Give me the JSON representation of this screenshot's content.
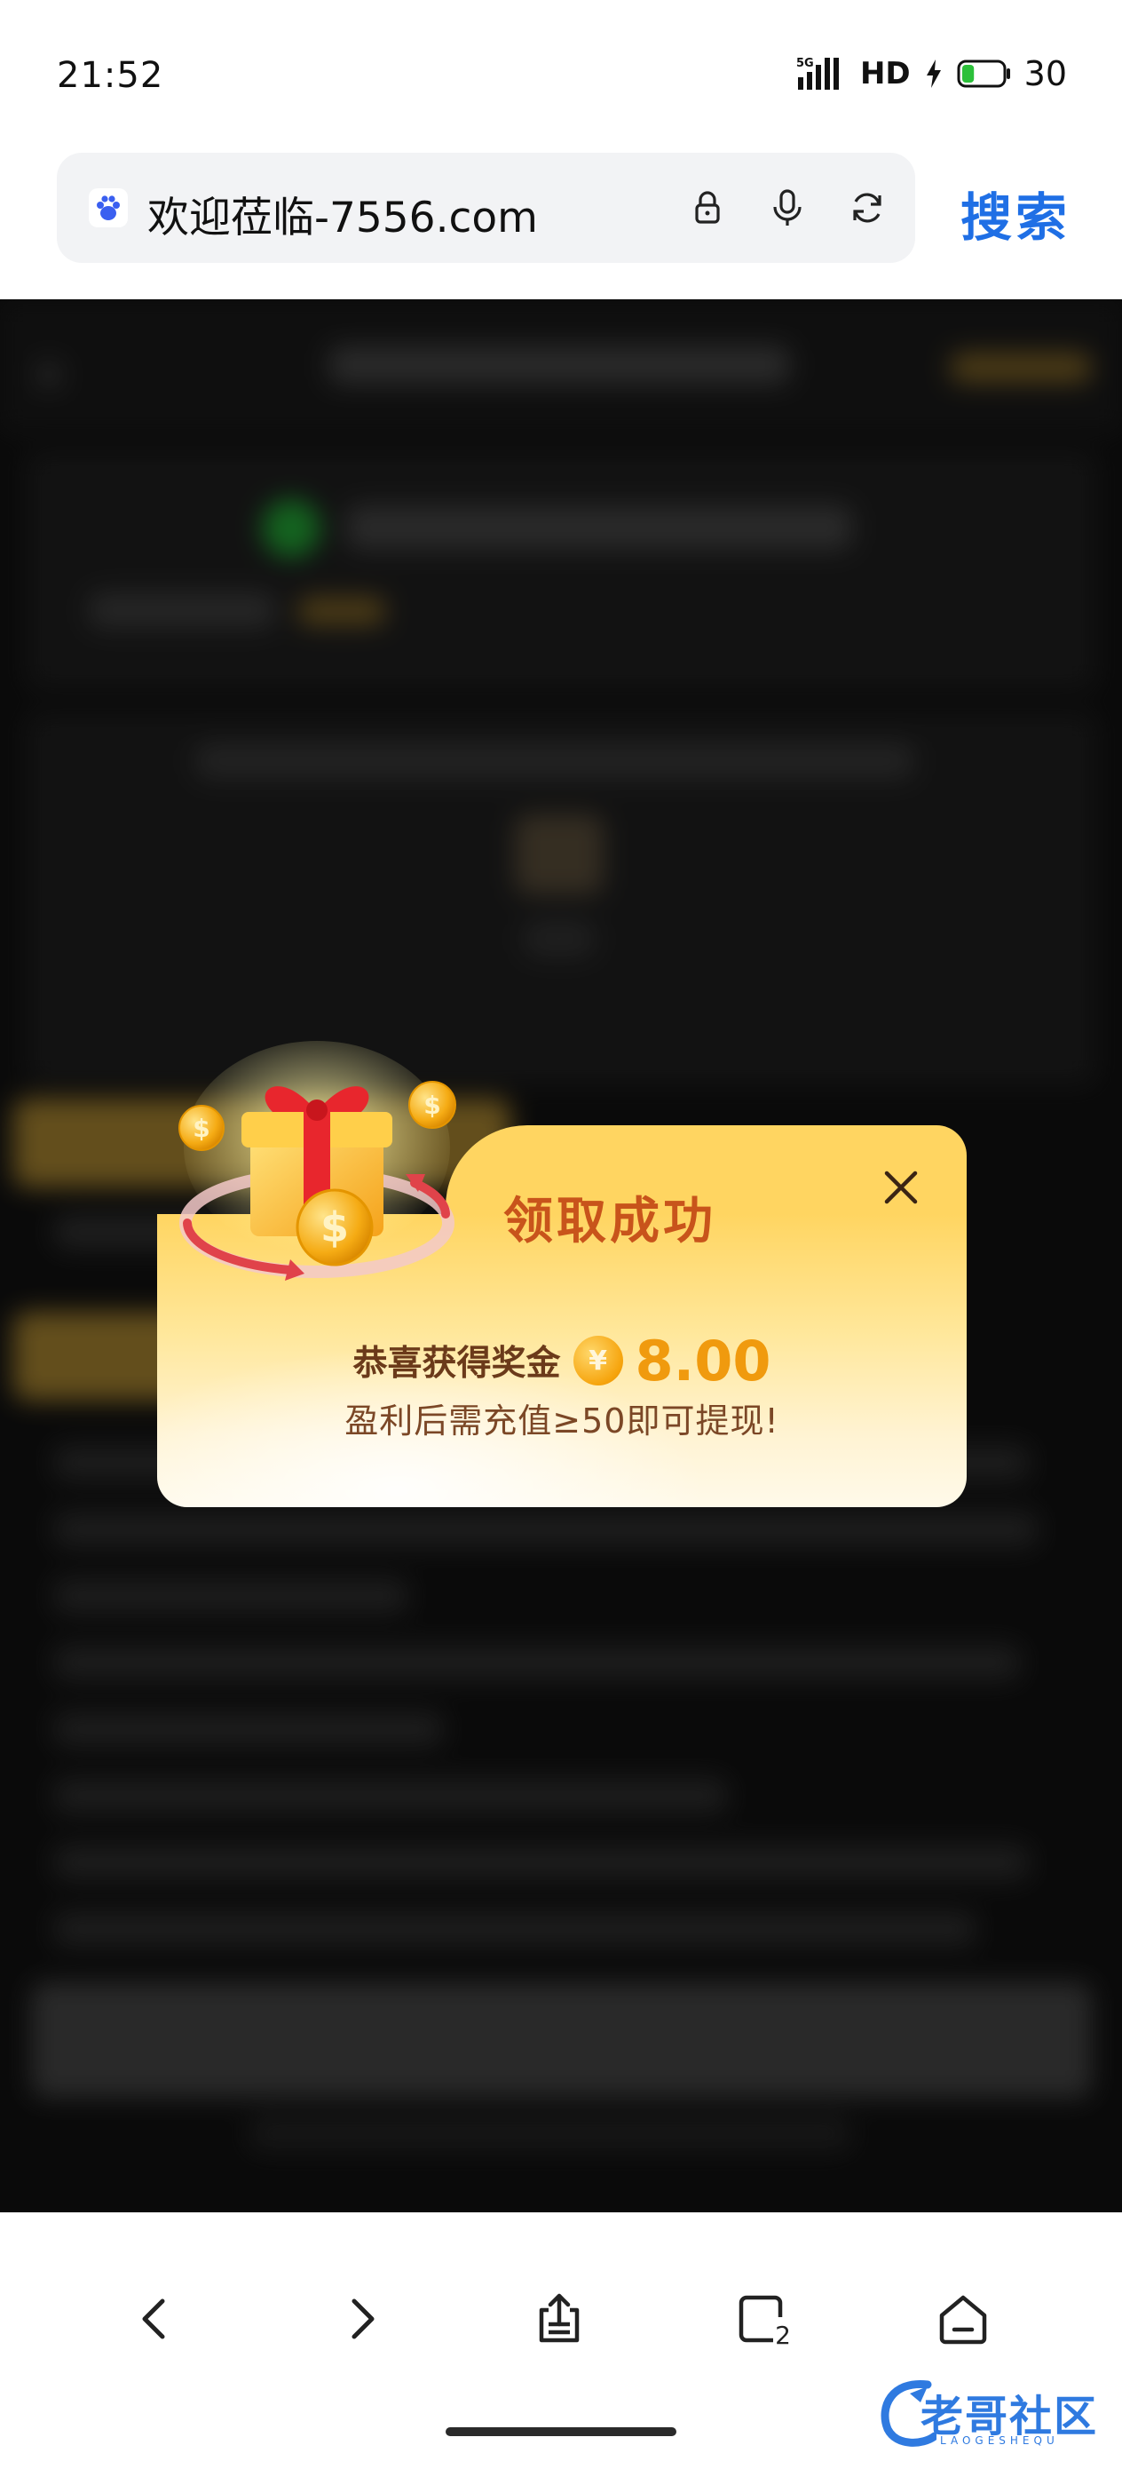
{
  "status_bar": {
    "time": "21:52",
    "network": "5G",
    "hd": "HD",
    "battery": "30",
    "battery_level": 0.3
  },
  "browser": {
    "url_title": "欢迎莅临-7556.com",
    "search_label": "搜索",
    "icons": [
      "baidu-paw-icon",
      "lock-icon",
      "microphone-icon",
      "refresh-icon"
    ]
  },
  "modal": {
    "title": "领取成功",
    "reward_label": "恭喜获得奖金",
    "currency_symbol": "¥",
    "amount": "8.00",
    "note": "盈利后需充值≥50即可提现!"
  },
  "bottom_nav": {
    "tab_count": "2",
    "items": [
      "back-icon",
      "forward-icon",
      "share-icon",
      "tabs-icon",
      "home-icon"
    ]
  },
  "watermark": {
    "text": "老哥社区",
    "sub": "LAOGESHEQU"
  },
  "colors": {
    "accent_blue": "#1f6fe5",
    "modal_title": "#c8541b",
    "amount": "#f09a0e",
    "modal_gold": "#ffd561"
  }
}
